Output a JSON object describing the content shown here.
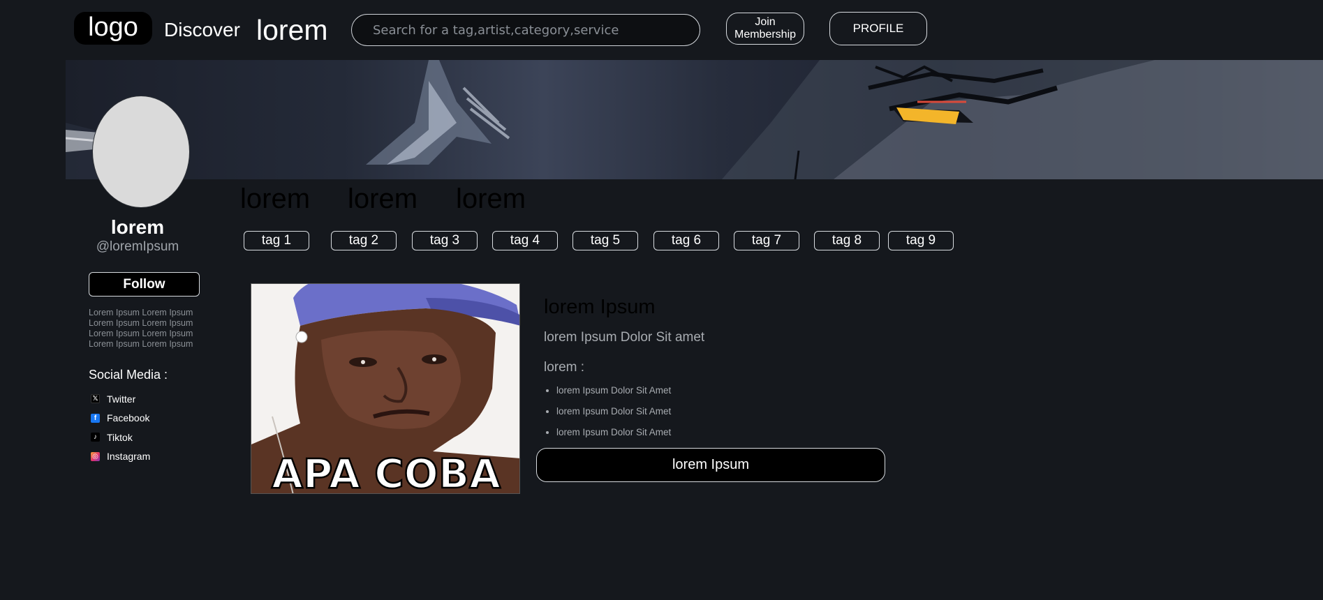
{
  "header": {
    "logo": "logo",
    "nav_discover": "Discover",
    "nav_lorem": "lorem",
    "search_placeholder": "Search for a tag,artist,category,service",
    "join_label": "Join Membership",
    "profile_label": "PROFILE"
  },
  "profile": {
    "name": "lorem",
    "handle": "@loremIpsum",
    "follow_label": "Follow",
    "bio": "Lorem Ipsum Lorem Ipsum Lorem Ipsum Lorem Ipsum Lorem Ipsum Lorem Ipsum Lorem Ipsum Lorem Ipsum",
    "social_title": "Social Media :",
    "social": [
      {
        "label": "Twitter",
        "icon": "x-icon"
      },
      {
        "label": "Facebook",
        "icon": "facebook-icon"
      },
      {
        "label": "Tiktok",
        "icon": "tiktok-icon"
      },
      {
        "label": "Instagram",
        "icon": "instagram-icon"
      }
    ]
  },
  "main": {
    "sections": [
      "lorem",
      "lorem",
      "lorem"
    ],
    "tags": [
      "tag 1",
      "tag 2",
      "tag 3",
      "tag 4",
      "tag 5",
      "tag 6",
      "tag 7",
      "tag 8",
      "tag 9"
    ]
  },
  "post": {
    "image_caption": "APA COBA",
    "title": "lorem Ipsum",
    "subtitle": "lorem Ipsum Dolor Sit amet",
    "label": "lorem :",
    "items": [
      "lorem Ipsum Dolor Sit Amet",
      "lorem Ipsum Dolor Sit Amet",
      "lorem Ipsum Dolor Sit Amet"
    ],
    "cta_label": "lorem Ipsum"
  },
  "colors": {
    "background": "#15181d",
    "button_fill": "#000000",
    "button_border": "#d8dce0",
    "muted_text": "#a8acb1"
  }
}
